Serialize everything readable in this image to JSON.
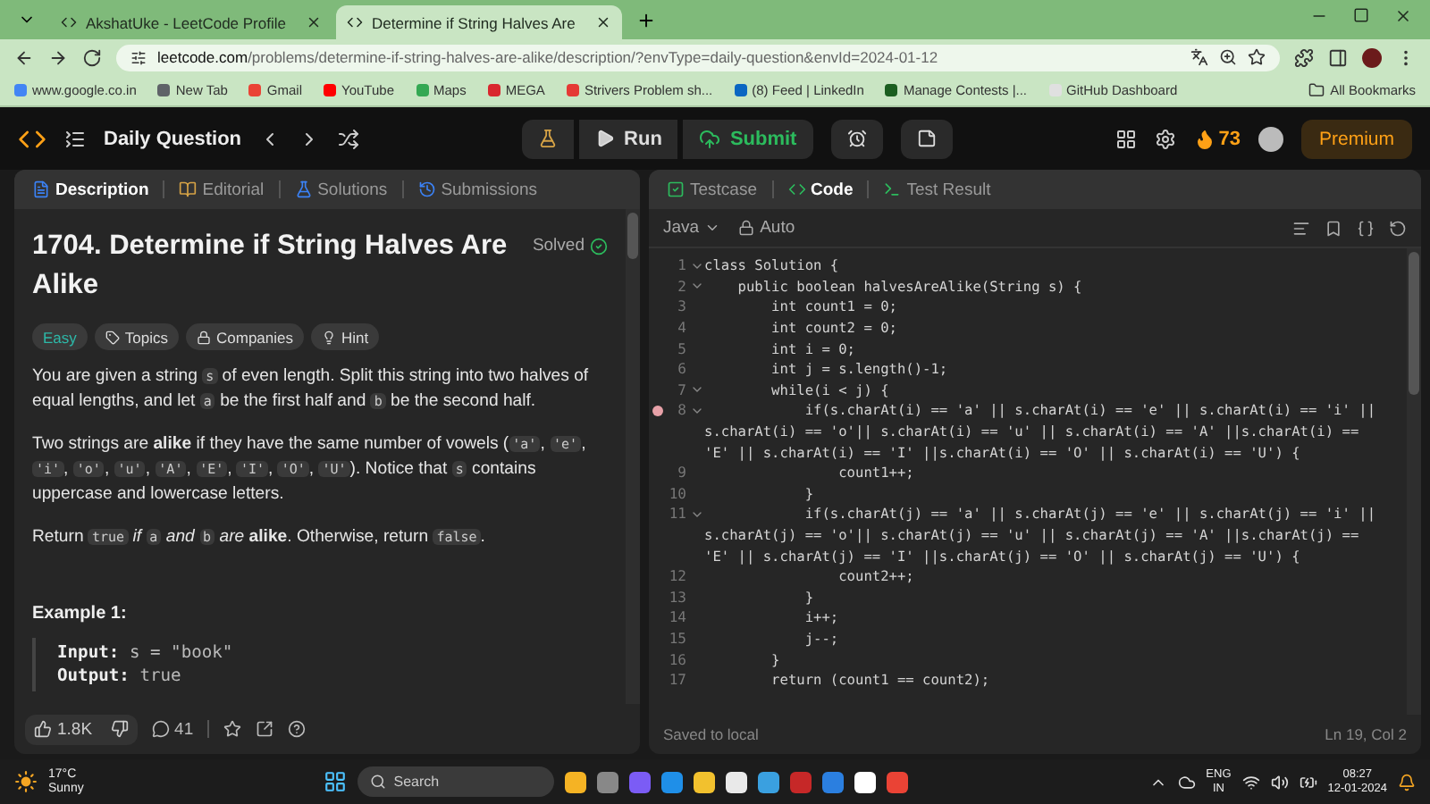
{
  "browser": {
    "tabs": [
      {
        "title": "AkshatUke - LeetCode Profile",
        "selected": false
      },
      {
        "title": "Determine if String Halves Are",
        "selected": true
      }
    ],
    "url_host": "leetcode.com",
    "url_path": "/problems/determine-if-string-halves-are-alike/description/?envType=daily-question&envId=2024-01-12",
    "bookmarks": [
      {
        "label": "www.google.co.in",
        "color": "#4285f4"
      },
      {
        "label": "New Tab",
        "color": "#5f6368"
      },
      {
        "label": "Gmail",
        "color": "#ea4335"
      },
      {
        "label": "YouTube",
        "color": "#ff0000"
      },
      {
        "label": "Maps",
        "color": "#34a853"
      },
      {
        "label": "MEGA",
        "color": "#d9272e"
      },
      {
        "label": "Strivers Problem sh...",
        "color": "#e53935"
      },
      {
        "label": "(8) Feed | LinkedIn",
        "color": "#0a66c2"
      },
      {
        "label": "Manage Contests |...",
        "color": "#1b5e20"
      },
      {
        "label": "GitHub Dashboard",
        "color": "#e0e0e0"
      }
    ],
    "all_bookmarks": "All Bookmarks"
  },
  "navbar": {
    "title": "Daily Question",
    "run": "Run",
    "submit": "Submit",
    "streak": "73",
    "premium": "Premium"
  },
  "problem": {
    "tabs": [
      {
        "label": "Description",
        "selected": true
      },
      {
        "label": "Editorial",
        "selected": false
      },
      {
        "label": "Solutions",
        "selected": false
      },
      {
        "label": "Submissions",
        "selected": false
      }
    ],
    "title": "1704. Determine if String Halves Are Alike",
    "status": "Solved",
    "tags": [
      {
        "label": "Easy",
        "kind": "difficulty"
      },
      {
        "label": "Topics",
        "kind": "topics"
      },
      {
        "label": "Companies",
        "kind": "companies"
      },
      {
        "label": "Hint",
        "kind": "hint"
      }
    ],
    "paragraphs": [
      [
        {
          "text": "You are given a string ",
          "code": false
        },
        {
          "text": "s",
          "code": true
        },
        {
          "text": " of even length. Split this string into two halves of equal lengths, and let ",
          "code": false
        },
        {
          "text": "a",
          "code": true
        },
        {
          "text": " be the first half and ",
          "code": false
        },
        {
          "text": "b",
          "code": true
        },
        {
          "text": " be the second half.",
          "code": false
        }
      ],
      [
        {
          "text": "Two strings are **alike** if they have the same number of vowels (",
          "code": false
        },
        {
          "text": "'a'",
          "code": true
        },
        {
          "text": ", ",
          "code": false
        },
        {
          "text": "'e'",
          "code": true
        },
        {
          "text": ", ",
          "code": false
        },
        {
          "text": "'i'",
          "code": true
        },
        {
          "text": ", ",
          "code": false
        },
        {
          "text": "'o'",
          "code": true
        },
        {
          "text": ", ",
          "code": false
        },
        {
          "text": "'u'",
          "code": true
        },
        {
          "text": ", ",
          "code": false
        },
        {
          "text": "'A'",
          "code": true
        },
        {
          "text": ", ",
          "code": false
        },
        {
          "text": "'E'",
          "code": true
        },
        {
          "text": ", ",
          "code": false
        },
        {
          "text": "'I'",
          "code": true
        },
        {
          "text": ", ",
          "code": false
        },
        {
          "text": "'O'",
          "code": true
        },
        {
          "text": ", ",
          "code": false
        },
        {
          "text": "'U'",
          "code": true
        },
        {
          "text": "). Notice that ",
          "code": false
        },
        {
          "text": "s",
          "code": true
        },
        {
          "text": " contains uppercase and lowercase letters.",
          "code": false
        }
      ],
      [
        {
          "text": "Return ",
          "code": false
        },
        {
          "text": "true",
          "code": true
        },
        {
          "text": " *if* ",
          "code": false
        },
        {
          "text": "a",
          "code": true
        },
        {
          "text": " *and* ",
          "code": false
        },
        {
          "text": "b",
          "code": true
        },
        {
          "text": " *are* **alike**. Otherwise, return ",
          "code": false
        },
        {
          "text": "false",
          "code": true
        },
        {
          "text": ".",
          "code": false
        }
      ]
    ],
    "example": {
      "heading": "Example 1:",
      "lines": [
        {
          "label": "Input:",
          "value": "s = \"book\""
        },
        {
          "label": "Output:",
          "value": "true"
        }
      ]
    },
    "likes": "1.8K",
    "comments": "41"
  },
  "editor": {
    "tabs": [
      {
        "label": "Testcase",
        "selected": false
      },
      {
        "label": "Code",
        "selected": true
      },
      {
        "label": "Test Result",
        "selected": false
      }
    ],
    "language": "Java",
    "mode": "Auto",
    "lines": [
      {
        "kind": "line",
        "number": "1",
        "fold": true,
        "breakpoint": false,
        "text": "class Solution {"
      },
      {
        "kind": "line",
        "number": "2",
        "fold": true,
        "breakpoint": false,
        "text": "    public boolean halvesAreAlike(String s) {"
      },
      {
        "kind": "line",
        "number": "3",
        "fold": false,
        "breakpoint": false,
        "text": "        int count1 = 0;"
      },
      {
        "kind": "line",
        "number": "4",
        "fold": false,
        "breakpoint": false,
        "text": "        int count2 = 0;"
      },
      {
        "kind": "line",
        "number": "5",
        "fold": false,
        "breakpoint": false,
        "text": "        int i = 0;"
      },
      {
        "kind": "line",
        "number": "6",
        "fold": false,
        "breakpoint": false,
        "text": "        int j = s.length()-1;"
      },
      {
        "kind": "line",
        "number": "7",
        "fold": true,
        "breakpoint": false,
        "text": "        while(i < j) {"
      },
      {
        "kind": "line",
        "number": "8",
        "fold": true,
        "breakpoint": true,
        "text": "            if(s.charAt(i) == 'a' || s.charAt(i) == 'e' || s.charAt(i) == 'i' ||"
      },
      {
        "kind": "wrap",
        "text": "s.charAt(i) == 'o'|| s.charAt(i) == 'u' || s.charAt(i) == 'A' ||s.charAt(i) =="
      },
      {
        "kind": "wrap",
        "text": "'E' || s.charAt(i) == 'I' ||s.charAt(i) == 'O' || s.charAt(i) == 'U') {"
      },
      {
        "kind": "line",
        "number": "9",
        "fold": false,
        "breakpoint": false,
        "text": "                count1++;"
      },
      {
        "kind": "line",
        "number": "10",
        "fold": false,
        "breakpoint": false,
        "text": "            }"
      },
      {
        "kind": "line",
        "number": "11",
        "fold": true,
        "breakpoint": false,
        "text": "            if(s.charAt(j) == 'a' || s.charAt(j) == 'e' || s.charAt(j) == 'i' ||"
      },
      {
        "kind": "wrap",
        "text": "s.charAt(j) == 'o'|| s.charAt(j) == 'u' || s.charAt(j) == 'A' ||s.charAt(j) =="
      },
      {
        "kind": "wrap",
        "text": "'E' || s.charAt(j) == 'I' ||s.charAt(j) == 'O' || s.charAt(j) == 'U') {"
      },
      {
        "kind": "line",
        "number": "12",
        "fold": false,
        "breakpoint": false,
        "text": "                count2++;"
      },
      {
        "kind": "line",
        "number": "13",
        "fold": false,
        "breakpoint": false,
        "text": "            }"
      },
      {
        "kind": "line",
        "number": "14",
        "fold": false,
        "breakpoint": false,
        "text": "            i++;"
      },
      {
        "kind": "line",
        "number": "15",
        "fold": false,
        "breakpoint": false,
        "text": "            j--;"
      },
      {
        "kind": "line",
        "number": "16",
        "fold": false,
        "breakpoint": false,
        "text": "        }"
      },
      {
        "kind": "line",
        "number": "17",
        "fold": false,
        "breakpoint": false,
        "text": "        return (count1 == count2);"
      }
    ],
    "status": "Saved to local",
    "cursor": "Ln 19, Col 2"
  },
  "taskbar": {
    "temperature": "17°C",
    "condition": "Sunny",
    "search": "Search",
    "language": "ENG",
    "region": "IN",
    "time": "08:27",
    "date": "12-01-2024"
  }
}
